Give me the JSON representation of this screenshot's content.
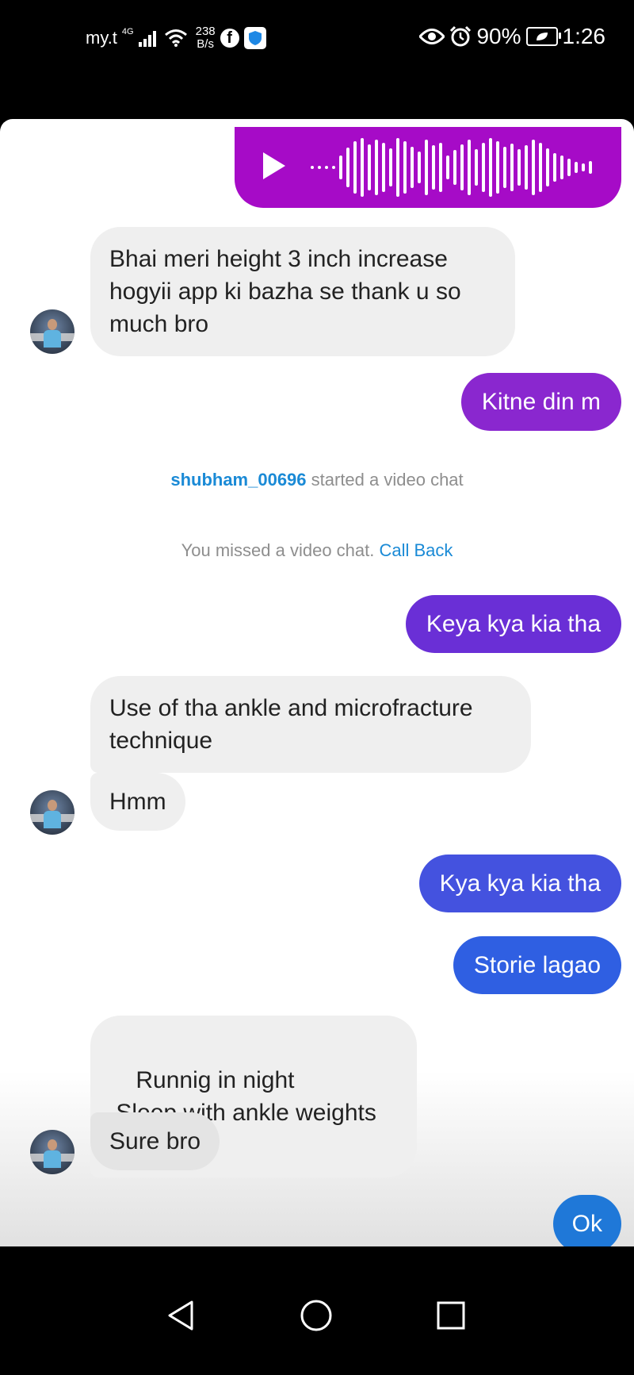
{
  "status_bar": {
    "carrier": "my.t",
    "network": "4G",
    "speed_value": "238",
    "speed_unit": "B/s",
    "battery": "90%",
    "time": "1:26"
  },
  "conversation": {
    "voice_message": {
      "type": "audio"
    },
    "messages": [
      {
        "id": "m1",
        "text": "Bhai meri height 3 inch increase hogyii app ki bazha se thank u so much bro"
      },
      {
        "id": "m2",
        "text": "Kitne din m"
      },
      {
        "id": "m3",
        "text": "Keya kya kia tha"
      },
      {
        "id": "m4",
        "text": "Use of tha ankle and microfracture technique"
      },
      {
        "id": "m5",
        "text": "Hmm"
      },
      {
        "id": "m6",
        "text": "Kya kya kia tha"
      },
      {
        "id": "m7",
        "text": "Storie lagao"
      },
      {
        "id": "m8",
        "text": "Runnig in night\n Sleep with ankle weights"
      },
      {
        "id": "m9",
        "text": "Sure bro"
      },
      {
        "id": "m10",
        "text": "Ok"
      }
    ],
    "system": {
      "video_chat_user": "shubham_00696",
      "video_chat_text": " started a video chat",
      "missed_text": "You missed a video chat. ",
      "call_back": "Call Back"
    }
  },
  "colors": {
    "voice_bubble": "#a60bc7",
    "bubble_kitne": "#8a27cf",
    "bubble_keya": "#6a2fd6",
    "bubble_kya": "#4452df",
    "bubble_storie": "#2f5fe2",
    "bubble_ok": "#1f78d8",
    "link": "#1a8ad6"
  },
  "nav_bar": {
    "back": "back-icon",
    "home": "home-icon",
    "recents": "recents-icon"
  }
}
